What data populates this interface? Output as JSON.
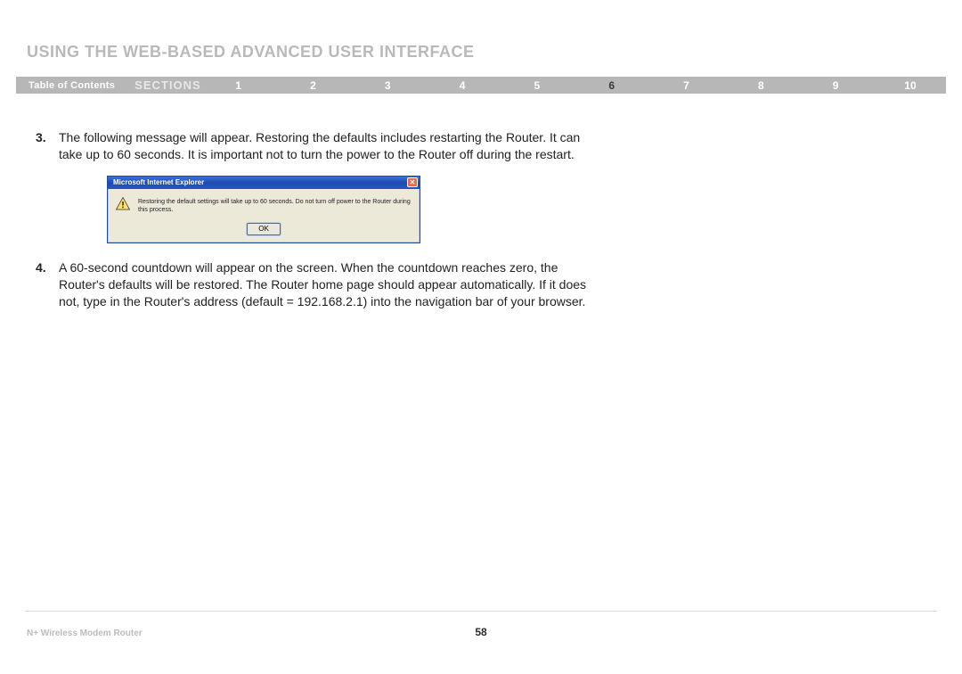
{
  "page_title": "USING THE WEB-BASED ADVANCED USER INTERFACE",
  "nav": {
    "toc": "Table of Contents",
    "sections_label": "SECTIONS",
    "items": [
      "1",
      "2",
      "3",
      "4",
      "5",
      "6",
      "7",
      "8",
      "9",
      "10"
    ],
    "current_index": 5
  },
  "steps": {
    "step3": {
      "num": "3.",
      "text": "The following message will appear. Restoring the defaults includes restarting the Router. It can take up to 60 seconds. It is important not to turn the power to the Router off during the restart."
    },
    "step4": {
      "num": "4.",
      "text": "A 60-second countdown will appear on the screen. When the countdown reaches zero, the Router's defaults will be restored. The Router home page should appear automatically. If it does not, type in the Router's address (default = 192.168.2.1) into the navigation bar of your browser."
    }
  },
  "dialog": {
    "title": "Microsoft Internet Explorer",
    "close": "✕",
    "message": "Restoring the default settings will take up to 60 seconds. Do not turn off power to the Router during this process.",
    "ok": "OK"
  },
  "footer": {
    "product": "N+ Wireless Modem Router",
    "page": "58"
  }
}
